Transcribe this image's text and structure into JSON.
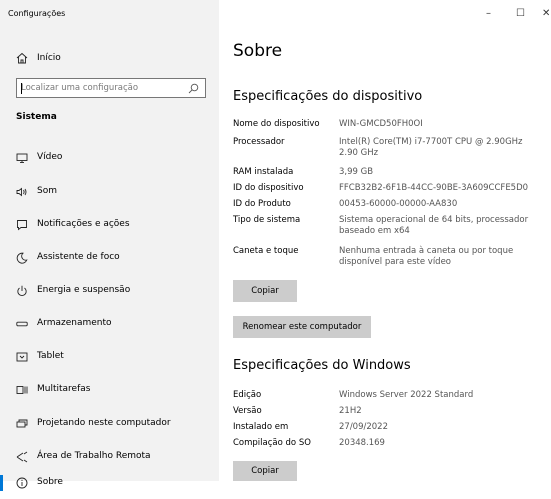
{
  "window": {
    "title": "Configurações",
    "minimize": "–",
    "maximize": "☐",
    "close": "✕"
  },
  "sidebar": {
    "home_label": "Início",
    "search_placeholder": "Localizar uma configuração",
    "section_title": "Sistema",
    "items": [
      {
        "label": "Vídeo",
        "icon": "monitor-icon"
      },
      {
        "label": "Som",
        "icon": "speaker-icon"
      },
      {
        "label": "Notificações e ações",
        "icon": "notification-icon"
      },
      {
        "label": "Assistente de foco",
        "icon": "moon-icon"
      },
      {
        "label": "Energia e suspensão",
        "icon": "power-icon"
      },
      {
        "label": "Armazenamento",
        "icon": "storage-icon"
      },
      {
        "label": "Tablet",
        "icon": "tablet-icon"
      },
      {
        "label": "Multitarefas",
        "icon": "multitask-icon"
      },
      {
        "label": "Projetando neste computador",
        "icon": "projector-icon"
      },
      {
        "label": "Área de Trabalho Remota",
        "icon": "remote-desktop-icon"
      },
      {
        "label": "Sobre",
        "icon": "info-icon",
        "selected": true
      }
    ]
  },
  "main": {
    "title": "Sobre",
    "device_specs": {
      "heading": "Especificações do dispositivo",
      "rows": [
        {
          "key": "Nome do dispositivo",
          "value": "WIN-GMCD50FH0OI"
        },
        {
          "key": "Processador",
          "value": "Intel(R) Core(TM) i7-7700T CPU @ 2.90GHz 2.90 GHz"
        },
        {
          "key": "RAM instalada",
          "value": "3,99 GB"
        },
        {
          "key": "ID do dispositivo",
          "value": "FFCB32B2-6F1B-44CC-90BE-3A609CCFE5D0"
        },
        {
          "key": "ID do Produto",
          "value": "00453-60000-00000-AA830"
        },
        {
          "key": "Tipo de sistema",
          "value": "Sistema operacional de 64 bits, processador baseado em x64"
        },
        {
          "key": "Caneta e toque",
          "value": "Nenhuma entrada à caneta ou por toque disponível para este vídeo"
        }
      ],
      "copy_label": "Copiar",
      "rename_label": "Renomear este computador"
    },
    "windows_specs": {
      "heading": "Especificações do Windows",
      "rows": [
        {
          "key": "Edição",
          "value": "Windows Server 2022 Standard"
        },
        {
          "key": "Versão",
          "value": "21H2"
        },
        {
          "key": "Instalado em",
          "value": "27/09/2022"
        },
        {
          "key": "Compilação do SO",
          "value": "20348.169"
        }
      ],
      "copy_label": "Copiar"
    }
  }
}
